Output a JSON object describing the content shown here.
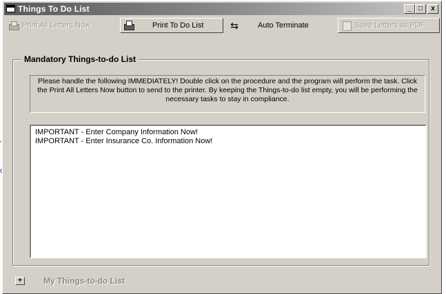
{
  "window": {
    "title": "Things To Do List",
    "minimize_glyph": "_",
    "maximize_glyph": "□",
    "close_glyph": "x"
  },
  "toolbar": {
    "print_all_letters": "Print All Letters Now",
    "print_to_do_list": "Print To Do List",
    "auto_terminate": "Auto Terminate",
    "save_letters_pdf": "Save Letters as PDF"
  },
  "mandatory_group": {
    "title": "Mandatory Things-to-do List",
    "instructions": "Please handle the following IMMEDIATELY!  Double click on the procedure and the program will perform the task.  Click the Print All Letters Now button to send to the printer.  By keeping the Things-to-do list empty, you will be performing the necessary tasks to stay in compliance.",
    "items": [
      "IMPORTANT - Enter Company Information Now!",
      "IMPORTANT - Enter Insurance Co. Information Now!"
    ]
  },
  "footer": {
    "toggle_glyph": "+",
    "label": "My Things-to-do List"
  },
  "colors": {
    "face": "#d4d0c8",
    "title_start": "#5a5a5a",
    "title_end": "#c8c8c8",
    "disabled_text": "#a09c94"
  }
}
